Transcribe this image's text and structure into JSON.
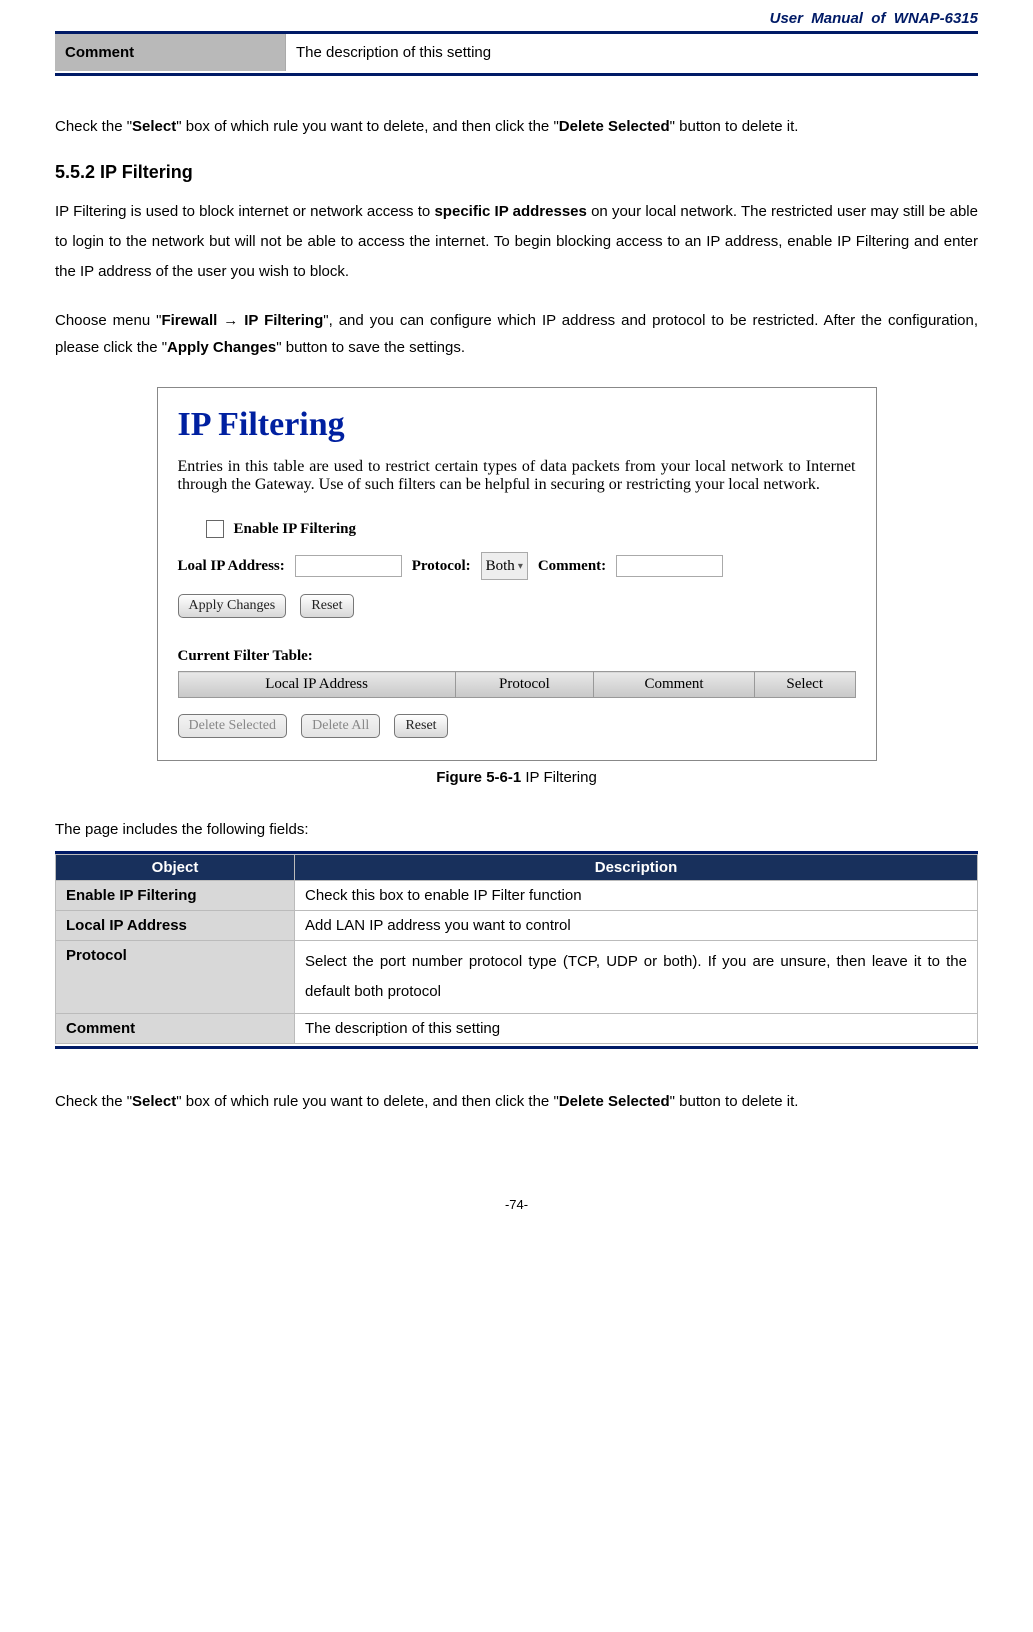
{
  "header": {
    "title": "User  Manual  of  WNAP-6315"
  },
  "comment_row": {
    "label": "Comment",
    "desc": "The description of this setting"
  },
  "para1_pre": "Check the \"",
  "para1_b1": "Select",
  "para1_mid": "\" box of which rule you want to delete, and then click the \"",
  "para1_b2": "Delete Selected",
  "para1_post": "\" button to delete it.",
  "section_heading": "5.5.2   IP Filtering",
  "para2_a": "IP Filtering is used to block internet or network access to ",
  "para2_b": "specific IP addresses",
  "para2_c": " on your local network. The restricted user may still be able to login to the network but will not be able to access the internet. To begin blocking access to an IP address, enable IP Filtering and enter the IP address of the user you wish to block.",
  "para3_a": "Choose menu \"",
  "para3_b1": "Firewall ",
  "para3_arrow": "→",
  "para3_b2": " IP Filtering",
  "para3_c": "\", and you can configure which IP address and protocol to be restricted. After the configuration, please click the \"",
  "para3_b3": "Apply Changes",
  "para3_d": "\" button to save the settings.",
  "screenshot": {
    "title": "IP Filtering",
    "desc": "Entries in this table are used to restrict certain types of data packets from your local network to Internet through the Gateway. Use of such filters can be helpful in securing or restricting your local network.",
    "enable_label": "Enable IP Filtering",
    "ip_label": "Loal IP Address:",
    "protocol_label": "Protocol:",
    "protocol_value": "Both",
    "comment_label": "Comment:",
    "apply_btn": "Apply Changes",
    "reset_btn": "Reset",
    "table_heading": "Current Filter Table:",
    "th1": "Local IP Address",
    "th2": "Protocol",
    "th3": "Comment",
    "th4": "Select",
    "delete_selected_btn": "Delete Selected",
    "delete_all_btn": "Delete All",
    "reset2_btn": "Reset"
  },
  "figure_caption_bold": "Figure 5-6-1",
  "figure_caption_rest": " IP Filtering",
  "fields_intro": "The page includes the following fields:",
  "fields_table": {
    "head_obj": "Object",
    "head_desc": "Description",
    "rows": [
      {
        "obj": "Enable IP Filtering",
        "desc": "Check this box to enable IP Filter function"
      },
      {
        "obj": "Local IP Address",
        "desc": "Add LAN IP address you want to control"
      },
      {
        "obj": "Protocol",
        "desc": "Select the port number protocol type (TCP, UDP or both). If you are unsure, then leave it to the default both protocol"
      },
      {
        "obj": "Comment",
        "desc": "The description of this setting"
      }
    ]
  },
  "para_last_pre": "Check the \"",
  "para_last_b1": "Select",
  "para_last_mid": "\" box of which rule you want to delete, and then click the \"",
  "para_last_b2": "Delete Selected",
  "para_last_post": "\" button to delete it.",
  "page_number": "-74-"
}
